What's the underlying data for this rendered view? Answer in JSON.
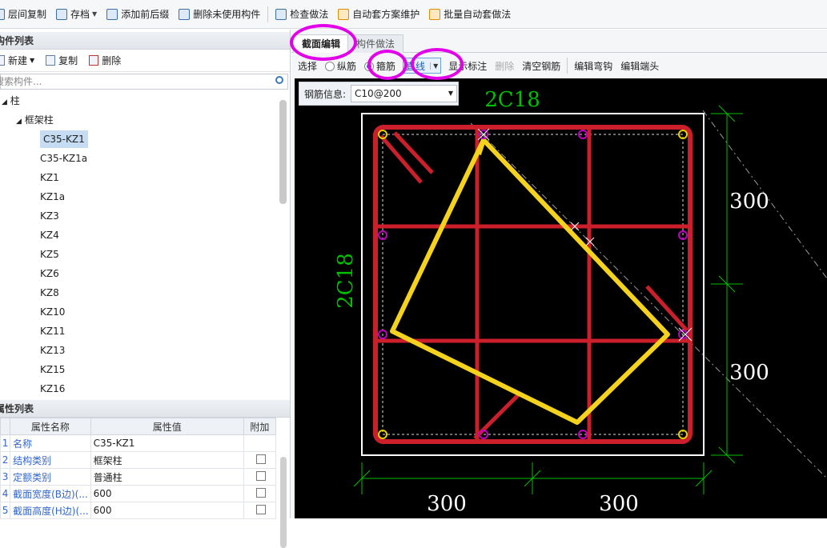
{
  "toolbar": {
    "items": [
      {
        "label": "层间复制",
        "icon": "copy-floors-icon"
      },
      {
        "label": "存档",
        "icon": "archive-icon",
        "dropdown": true
      },
      {
        "label": "添加前后缀",
        "icon": "add-prefix-icon"
      },
      {
        "label": "删除未使用构件",
        "icon": "delete-unused-icon"
      },
      {
        "label": "检查做法",
        "icon": "check-method-icon"
      },
      {
        "label": "自动套方案维护",
        "icon": "auto-scheme-icon"
      },
      {
        "label": "批量自动套做法",
        "icon": "batch-auto-icon"
      }
    ]
  },
  "component_list": {
    "header": "构件列表",
    "new_label": "新建",
    "copy_label": "复制",
    "delete_label": "删除",
    "search_placeholder": "搜索构件...",
    "tree": {
      "root": "柱",
      "group": "框架柱",
      "items": [
        "C35-KZ1",
        "C35-KZ1a",
        "KZ1",
        "KZ1a",
        "KZ3",
        "KZ4",
        "KZ5",
        "KZ6",
        "KZ8",
        "KZ10",
        "KZ11",
        "KZ13",
        "KZ15",
        "KZ16"
      ],
      "selected": "C35-KZ1"
    }
  },
  "property_list": {
    "header": "属性列表",
    "columns": [
      "属性名称",
      "属性值",
      "附加"
    ],
    "rows": [
      {
        "num": "1",
        "name": "名称",
        "value": "C35-KZ1",
        "extra": false,
        "checkbox": false
      },
      {
        "num": "2",
        "name": "结构类别",
        "value": "框架柱",
        "extra": false,
        "checkbox": true
      },
      {
        "num": "3",
        "name": "定额类别",
        "value": "普通柱",
        "extra": false,
        "checkbox": true
      },
      {
        "num": "4",
        "name": "截面宽度(B边)(...",
        "value": "600",
        "extra": false,
        "checkbox": true
      },
      {
        "num": "5",
        "name": "截面高度(H边)(...",
        "value": "600",
        "extra": false,
        "checkbox": true
      }
    ]
  },
  "editor": {
    "tabs": [
      "截面编辑",
      "构件做法"
    ],
    "active_tab": "截面编辑",
    "tools": {
      "select": "选择",
      "longitudinal": "纵筋",
      "stirrup": "箍筋",
      "shape": "直线",
      "show_labels": "显示标注",
      "delete": "删除",
      "clear": "清空钢筋",
      "edit_hook": "编辑弯钩",
      "edit_end": "编辑端头"
    },
    "rebar_info_label": "钢筋信息:",
    "rebar_info_value": "C10@200",
    "dims": {
      "top_label": "2C18",
      "left_label": "2C18",
      "right_upper": "300",
      "right_lower": "300",
      "bottom_left": "300",
      "bottom_right": "300"
    },
    "colors": {
      "rebar": "#cc1f2c",
      "stirrup_selected": "#f5d21e",
      "dimension": "#00c000",
      "corner_bar": "#e8d000",
      "side_bar": "#c000c0"
    }
  }
}
